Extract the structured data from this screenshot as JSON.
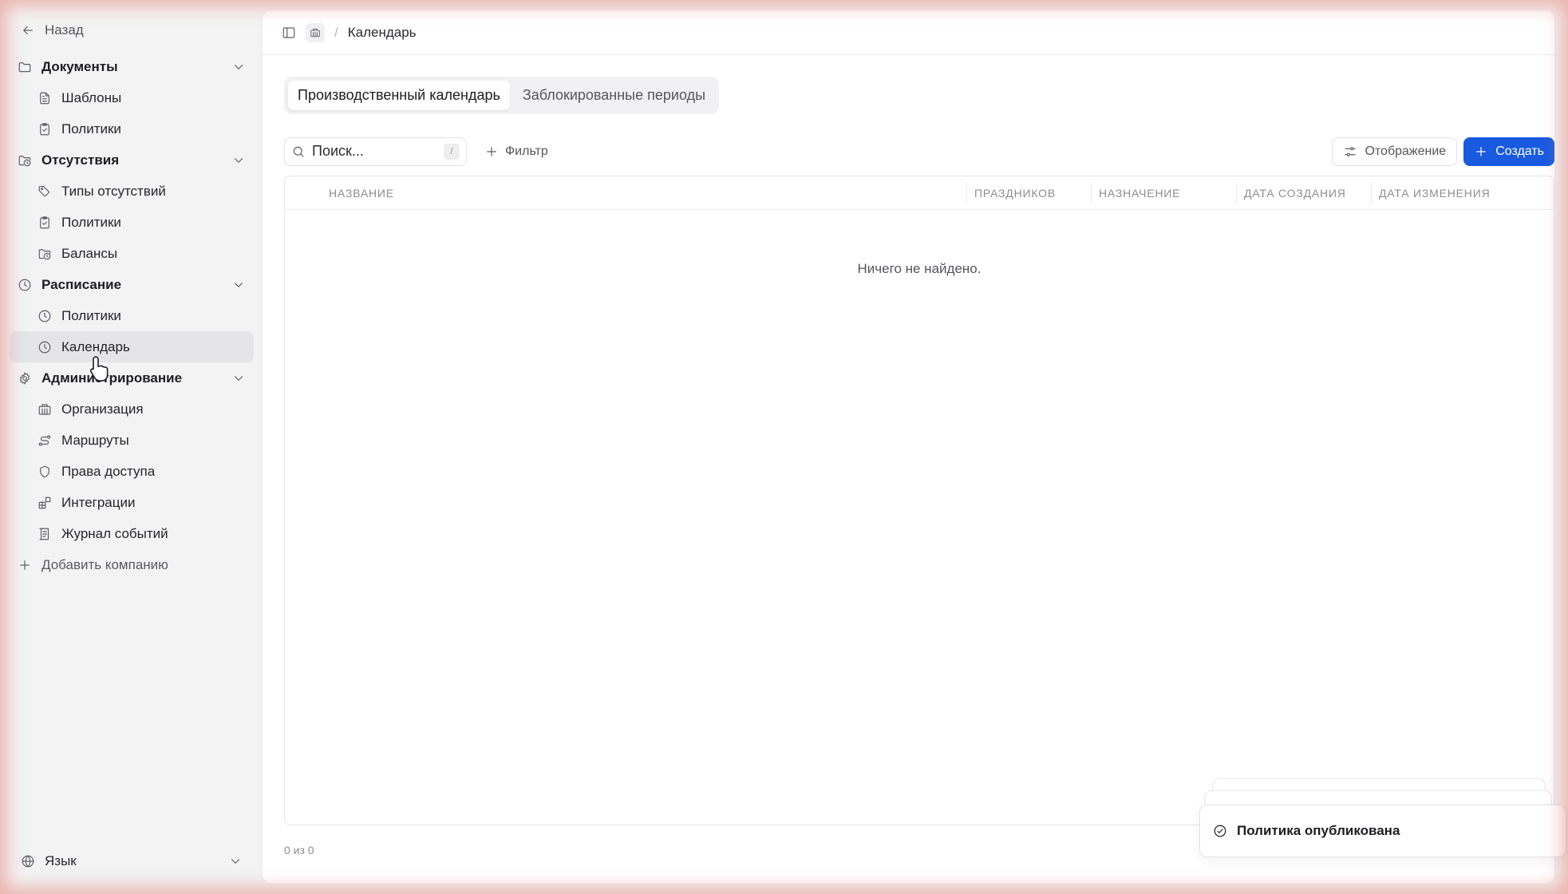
{
  "sidebar": {
    "back_label": "Назад",
    "groups": [
      {
        "label": "Документы",
        "icon": "folder-icon",
        "items": [
          {
            "label": "Шаблоны",
            "icon": "file-text-icon"
          },
          {
            "label": "Политики",
            "icon": "clipboard-check-icon"
          }
        ]
      },
      {
        "label": "Отсутствия",
        "icon": "folder-clock-icon",
        "items": [
          {
            "label": "Типы отсутствий",
            "icon": "tags-icon"
          },
          {
            "label": "Политики",
            "icon": "clipboard-check-icon"
          },
          {
            "label": "Балансы",
            "icon": "folder-clock-icon"
          }
        ]
      },
      {
        "label": "Расписание",
        "icon": "clock-icon",
        "items": [
          {
            "label": "Политики",
            "icon": "clock-icon"
          },
          {
            "label": "Календарь",
            "icon": "clock-icon",
            "active": true
          }
        ]
      },
      {
        "label": "Администрирование",
        "icon": "gear-icon",
        "items": [
          {
            "label": "Организация",
            "icon": "building-icon"
          },
          {
            "label": "Маршруты",
            "icon": "route-icon"
          },
          {
            "label": "Права доступа",
            "icon": "shield-icon"
          },
          {
            "label": "Интеграции",
            "icon": "blocks-icon"
          },
          {
            "label": "Журнал событий",
            "icon": "log-icon"
          }
        ]
      }
    ],
    "add_company_label": "Добавить компанию",
    "language_label": "Язык"
  },
  "topbar": {
    "breadcrumb_current": "Календарь"
  },
  "tabs": [
    {
      "label": "Производственный календарь",
      "active": true
    },
    {
      "label": "Заблокированные периоды",
      "active": false
    }
  ],
  "toolbar": {
    "search_placeholder": "Поиск...",
    "search_shortcut": "/",
    "filter_label": "Фильтр",
    "view_label": "Отображение",
    "create_label": "Создать"
  },
  "table": {
    "columns": [
      "Название",
      "Праздников",
      "Назначение",
      "Дата создания",
      "Дата изменения"
    ],
    "empty_text": "Ничего не найдено."
  },
  "pagination": {
    "count_text": "0 из 0"
  },
  "toast": {
    "message": "Политика опубликована"
  },
  "colors": {
    "accent": "#1a5ae0",
    "sidebar_bg": "#f3f3f4",
    "active_item_bg": "#e5e5e7"
  }
}
